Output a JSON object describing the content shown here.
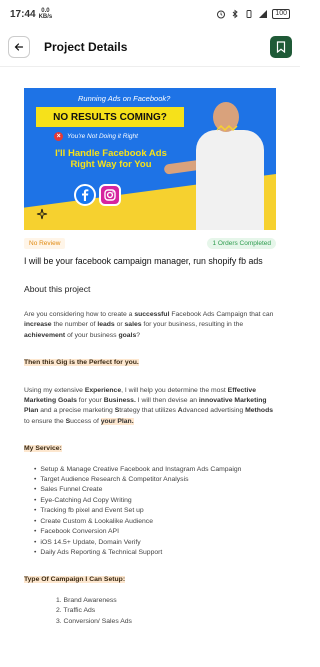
{
  "status": {
    "time": "17:44",
    "speed_value": "0.0",
    "speed_unit": "KB/s",
    "battery": "100"
  },
  "header": {
    "title": "Project Details"
  },
  "banner": {
    "top_text": "Running Ads on Facebook?",
    "headline": "NO RESULTS COMING?",
    "wrong_text": "You're Not Doing it Right",
    "handle_line1": "I'll Handle Facebook Ads",
    "handle_line2": "Right Way for You"
  },
  "tags": {
    "review": "No Review",
    "orders": "1 Orders Completed"
  },
  "gig": {
    "title": "I will be your facebook campaign manager, run shopify fb ads"
  },
  "about": {
    "heading": "About this project",
    "intro": {
      "t1": "Are you considering how to create a ",
      "b1": "successful",
      "t2": " Facebook Ads Campaign that can ",
      "b2": "increase",
      "t3": " the number of ",
      "b3": "leads",
      "t4": " or ",
      "b4": "sales",
      "t5": " for your business, resulting in the ",
      "b5": "achievement",
      "t6": " of your business ",
      "b6": "goals",
      "t7": "?"
    },
    "perfect": "Then this Gig is the Perfect for you.",
    "exp": {
      "t1": "Using my extensive ",
      "b1": "Experience",
      "t2": ", I will help you determine the most ",
      "b2": "Effective Marketing Goals",
      "t3": " for your ",
      "b3": "Business.",
      "t4": " I will then devise an ",
      "b4": "innovative Marketing Plan",
      "t5": " and a precise marketing ",
      "b5": "S",
      "t6": "trategy that utilizes ",
      "b6": "A",
      "t7": "dvanced advertising ",
      "b7": "Methods",
      "t8": " to ensure the ",
      "b8": "S",
      "t9": "uccess of ",
      "b9": "your Plan."
    },
    "service_heading": "My Service:",
    "services": [
      "Setup & Manage Creative Facebook and Instagram Ads Campaign",
      "Target Audience Research & Competitor Analysis",
      "Sales Funnel Create",
      "Eye-Catching Ad Copy Writing",
      "Tracking fb pixel and Event Set up",
      "Create Custom & Lookalike Audience",
      "Facebook Conversion API",
      "iOS 14.5+ Update, Domain Verify",
      "Daily Ads Reporting & Technical Support"
    ],
    "campaign_heading": "Type Of Campaign I Can Setup:",
    "campaigns": [
      "1. Brand Awareness",
      "2. Traffic Ads",
      "3. Conversion/ Sales Ads"
    ]
  }
}
